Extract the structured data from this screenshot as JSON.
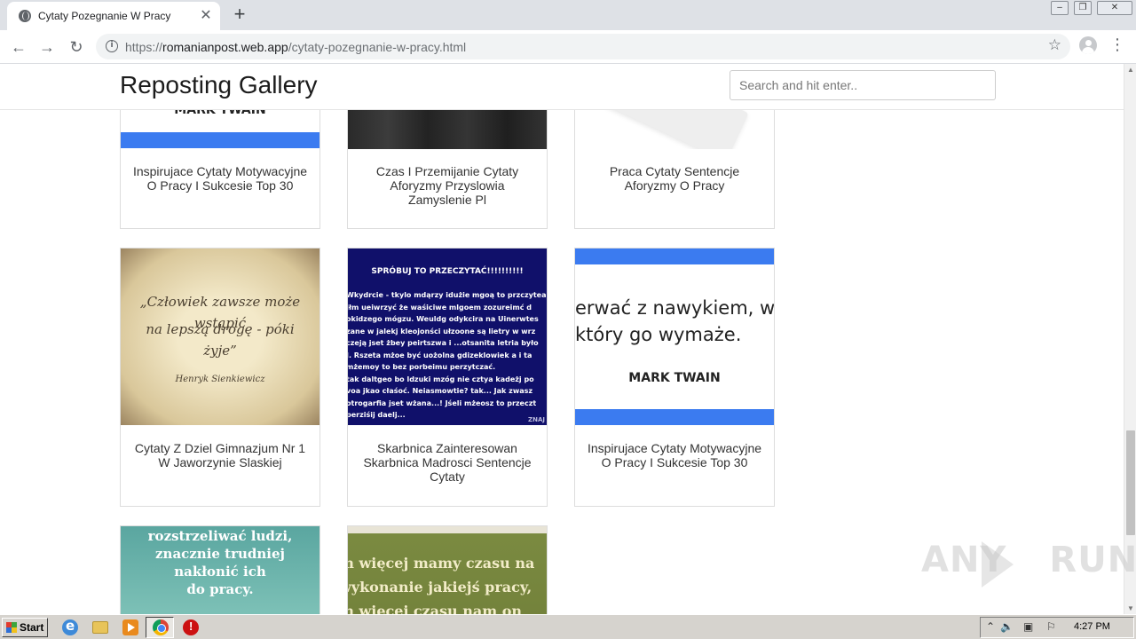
{
  "browser": {
    "tab_title": "Cytaty Pozegnanie W Pracy",
    "tab_close": "✕",
    "new_tab": "+",
    "url_scheme": "https://",
    "url_host": "romanianpost.web.app",
    "url_path": "/cytaty-pozegnanie-w-pracy.html",
    "info_glyph": "i",
    "star_glyph": "☆",
    "menu_glyph": "⋮",
    "nav_back": "←",
    "nav_forward": "→",
    "nav_reload": "↻",
    "win_minimize": "‒",
    "win_restore": "❐",
    "win_close": "✕"
  },
  "site": {
    "title": "Reposting Gallery",
    "search_placeholder": "Search and hit enter.."
  },
  "cards": [
    {
      "caption": "Inspirujace Cytaty Motywacyjne O Pracy I Sukcesie Top 30",
      "image": {
        "kind": "quote-banner",
        "author": "MARK TWAIN",
        "bar_color": "#3b7bf0"
      }
    },
    {
      "caption": "Czas I Przemijanie Cytaty Aforyzmy Przyslowia Zamyslenie Pl",
      "image": {
        "kind": "dark-texture"
      }
    },
    {
      "caption": "Praca Cytaty Sentencje Aforyzmy O Pracy",
      "image": {
        "kind": "keyboard-photo"
      }
    },
    {
      "caption": "Cytaty Z Dziel Gimnazjum Nr 1 W Jaworzynie Slaskiej",
      "image": {
        "kind": "parchment",
        "quote_lines": [
          "„Człowiek zawsze może wstąpić",
          "na lepszą drogę - póki żyje”"
        ],
        "author": "Henryk Sienkiewicz"
      }
    },
    {
      "caption": "Skarbnica Zainteresowan Skarbnica Madrosci Sentencje Cytaty",
      "image": {
        "kind": "navy-text",
        "heading": "SPRÓBUJ TO PRZECZYTAĆ!!!!!!!!!!",
        "body": "Wkydrcie - tkylo mdąrzy idużie mgoą to przczytea\nJłm ueiwrzyć że waśiciwe mlgoem zozureimć d\nokidzego mógzu. Weuldg odykcira na Uinerwtes\nzane w jalekj kleojonści ułzoone są lietry w wrz\nczeją jset żbey peirtszwa i ...otsanita letria było\nJ. Rszeta mżoe być uożolna gdizeklowiek a i ta\nmżemoy to bez porbeimu perzytczać.\ntak daltgeo bo ldzuki mzóg nie cztya kadeżj po\nvoa jkao cłaśoć. Neiasmowtie? tak... Jak zwasz\notrogarfia jset wżana...! Jśeli mżeosz to przeczt\nperziśij daelj...",
        "mark": "ZNAJ"
      }
    },
    {
      "caption": "Inspirujace Cytaty Motywacyjne O Pracy I Sukcesie Top 30",
      "image": {
        "kind": "quote-banner",
        "quote_lines": [
          "erwać z nawykiem, wy",
          "który go wymaże."
        ],
        "author": "MARK TWAIN",
        "bar_color": "#3b7bf0"
      }
    },
    {
      "caption": "",
      "image": {
        "kind": "teal-text",
        "lines": [
          "rozstrzeliwać ludzi,",
          "znacznie trudniej",
          "nakłonić ich",
          "do pracy."
        ]
      }
    },
    {
      "caption": "",
      "image": {
        "kind": "olive-text",
        "lines": [
          "m więcej mamy czasu na",
          "wykonanie jakiejś pracy,",
          "m więcej czasu nam on"
        ]
      }
    }
  ],
  "watermark": {
    "text_left": "ANY",
    "text_right": "RUN"
  },
  "taskbar": {
    "start_label": "Start",
    "apps": [
      "internet-explorer-icon",
      "folder-icon",
      "media-player-icon",
      "chrome-icon",
      "stop-icon"
    ],
    "tray_arrow": "⌃",
    "clock": "4:27 PM"
  }
}
